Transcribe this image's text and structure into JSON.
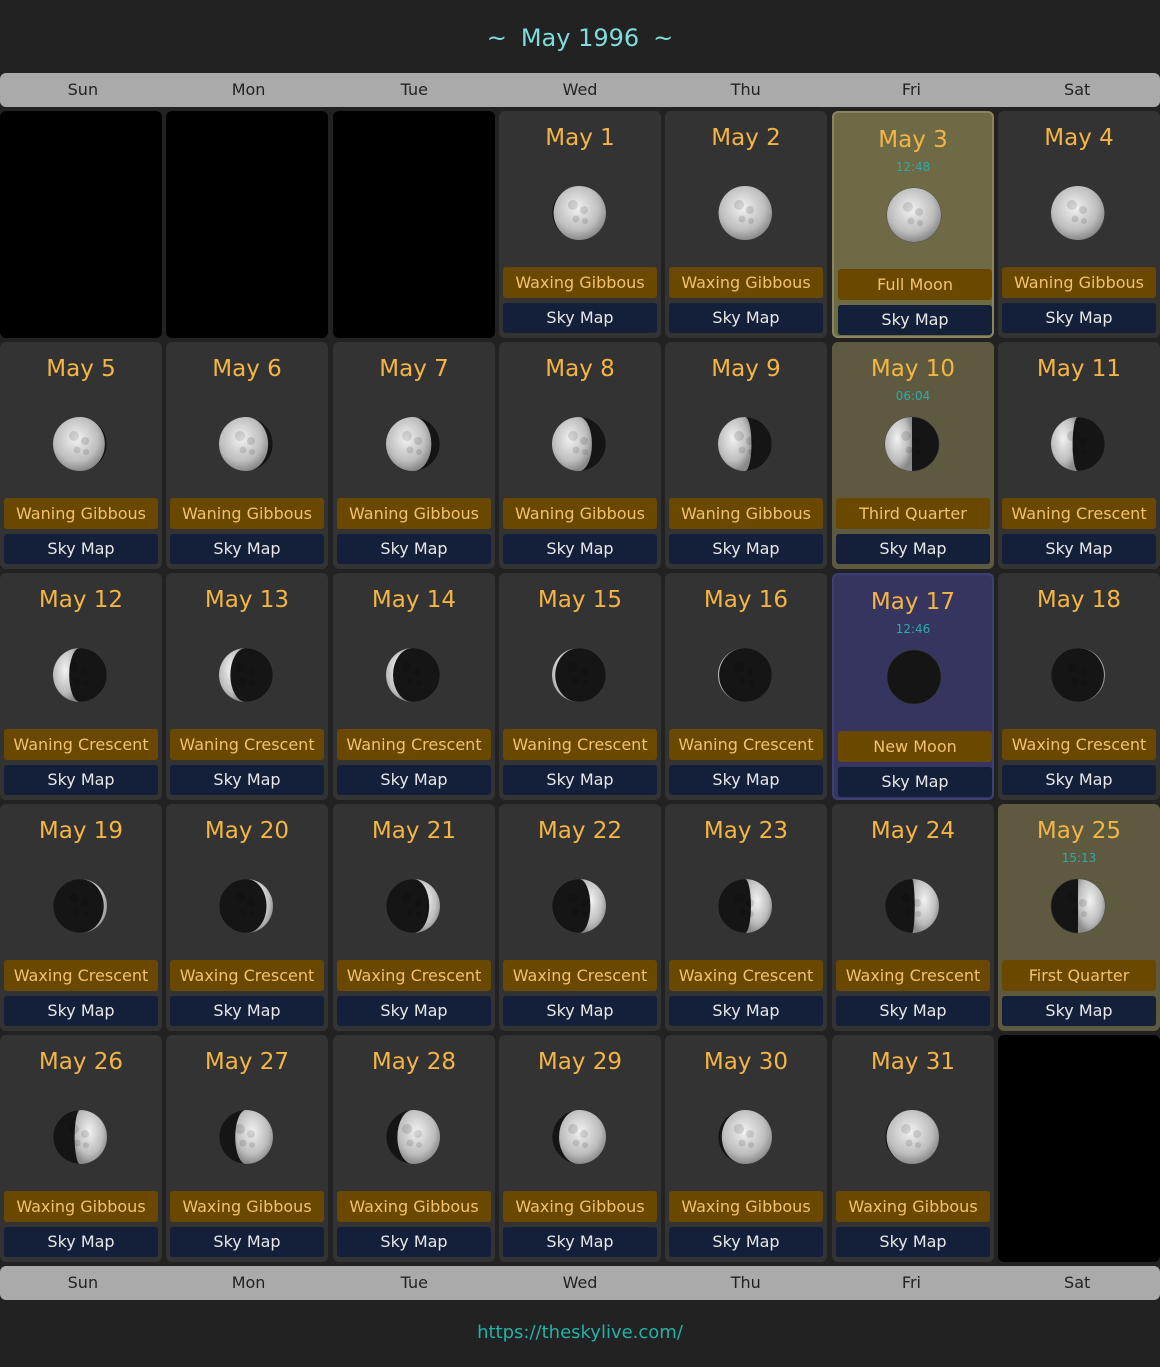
{
  "header": {
    "tilde_left": "~",
    "title": "May 1996",
    "tilde_right": "~"
  },
  "weekdays": [
    "Sun",
    "Mon",
    "Tue",
    "Wed",
    "Thu",
    "Fri",
    "Sat"
  ],
  "sky_map_label": "Sky Map",
  "leading_empty_days": 3,
  "days": [
    {
      "label": "May 1",
      "phase": "Waxing Gibbous",
      "illum": 0.97,
      "waxing": true
    },
    {
      "label": "May 2",
      "phase": "Waxing Gibbous",
      "illum": 0.99,
      "waxing": true
    },
    {
      "label": "May 3",
      "phase": "Full Moon",
      "time": "12:48",
      "illum": 1.0,
      "waxing": false,
      "highlight": "full"
    },
    {
      "label": "May 4",
      "phase": "Waning Gibbous",
      "illum": 0.99,
      "waxing": false
    },
    {
      "label": "May 5",
      "phase": "Waning Gibbous",
      "illum": 0.96,
      "waxing": false
    },
    {
      "label": "May 6",
      "phase": "Waning Gibbous",
      "illum": 0.91,
      "waxing": false
    },
    {
      "label": "May 7",
      "phase": "Waning Gibbous",
      "illum": 0.84,
      "waxing": false
    },
    {
      "label": "May 8",
      "phase": "Waning Gibbous",
      "illum": 0.74,
      "waxing": false
    },
    {
      "label": "May 9",
      "phase": "Waning Gibbous",
      "illum": 0.62,
      "waxing": false
    },
    {
      "label": "May 10",
      "phase": "Third Quarter",
      "time": "06:04",
      "illum": 0.5,
      "waxing": false,
      "highlight": "quarter"
    },
    {
      "label": "May 11",
      "phase": "Waning Crescent",
      "illum": 0.4,
      "waxing": false
    },
    {
      "label": "May 12",
      "phase": "Waning Crescent",
      "illum": 0.3,
      "waxing": false
    },
    {
      "label": "May 13",
      "phase": "Waning Crescent",
      "illum": 0.21,
      "waxing": false
    },
    {
      "label": "May 14",
      "phase": "Waning Crescent",
      "illum": 0.13,
      "waxing": false
    },
    {
      "label": "May 15",
      "phase": "Waning Crescent",
      "illum": 0.06,
      "waxing": false
    },
    {
      "label": "May 16",
      "phase": "Waning Crescent",
      "illum": 0.02,
      "waxing": false
    },
    {
      "label": "May 17",
      "phase": "New Moon",
      "time": "12:46",
      "illum": 0.0,
      "waxing": true,
      "highlight": "new"
    },
    {
      "label": "May 18",
      "phase": "Waxing Crescent",
      "illum": 0.02,
      "waxing": true
    },
    {
      "label": "May 19",
      "phase": "Waxing Crescent",
      "illum": 0.06,
      "waxing": true
    },
    {
      "label": "May 20",
      "phase": "Waxing Crescent",
      "illum": 0.12,
      "waxing": true
    },
    {
      "label": "May 21",
      "phase": "Waxing Crescent",
      "illum": 0.2,
      "waxing": true
    },
    {
      "label": "May 22",
      "phase": "Waxing Crescent",
      "illum": 0.29,
      "waxing": true
    },
    {
      "label": "May 23",
      "phase": "Waxing Crescent",
      "illum": 0.39,
      "waxing": true
    },
    {
      "label": "May 24",
      "phase": "Waxing Crescent",
      "illum": 0.45,
      "waxing": true
    },
    {
      "label": "May 25",
      "phase": "First Quarter",
      "time": "15:13",
      "illum": 0.5,
      "waxing": true,
      "highlight": "quarter"
    },
    {
      "label": "May 26",
      "phase": "Waxing Gibbous",
      "illum": 0.6,
      "waxing": true
    },
    {
      "label": "May 27",
      "phase": "Waxing Gibbous",
      "illum": 0.7,
      "waxing": true
    },
    {
      "label": "May 28",
      "phase": "Waxing Gibbous",
      "illum": 0.79,
      "waxing": true
    },
    {
      "label": "May 29",
      "phase": "Waxing Gibbous",
      "illum": 0.87,
      "waxing": true
    },
    {
      "label": "May 30",
      "phase": "Waxing Gibbous",
      "illum": 0.93,
      "waxing": true
    },
    {
      "label": "May 31",
      "phase": "Waxing Gibbous",
      "illum": 0.97,
      "waxing": true
    }
  ],
  "footer": {
    "link": "https://theskylive.com/"
  }
}
